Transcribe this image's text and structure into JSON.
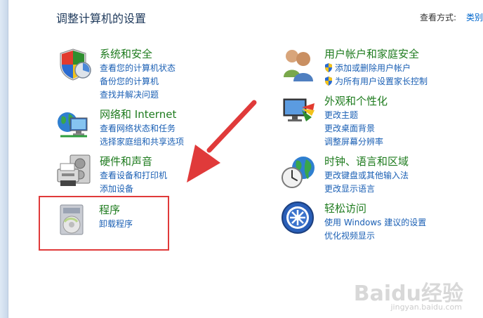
{
  "page_title": "调整计算机的设置",
  "view_by": {
    "label": "查看方式:",
    "value": "类别"
  },
  "categories": [
    {
      "title": "系统和安全",
      "links": [
        "查看您的计算机状态",
        "备份您的计算机",
        "查找并解决问题"
      ]
    },
    {
      "title": "网络和 Internet",
      "links": [
        "查看网络状态和任务",
        "选择家庭组和共享选项"
      ]
    },
    {
      "title": "硬件和声音",
      "links": [
        "查看设备和打印机",
        "添加设备"
      ]
    },
    {
      "title": "程序",
      "links": [
        "卸载程序"
      ]
    },
    {
      "title": "用户帐户和家庭安全",
      "links": [
        "添加或删除用户帐户",
        "为所有用户设置家长控制"
      ]
    },
    {
      "title": "外观和个性化",
      "links": [
        "更改主题",
        "更改桌面背景",
        "调整屏幕分辨率"
      ]
    },
    {
      "title": "时钟、语言和区域",
      "links": [
        "更改键盘或其他输入法",
        "更改显示语言"
      ]
    },
    {
      "title": "轻松访问",
      "links": [
        "使用 Windows 建议的设置",
        "优化视频显示"
      ]
    }
  ],
  "watermark": {
    "text": "Baidu经验",
    "sub": "jingyan.baidu.com"
  },
  "colors": {
    "category_title": "#1e7b1e",
    "link": "#1a5fb4",
    "highlight": "#e03a3a"
  }
}
